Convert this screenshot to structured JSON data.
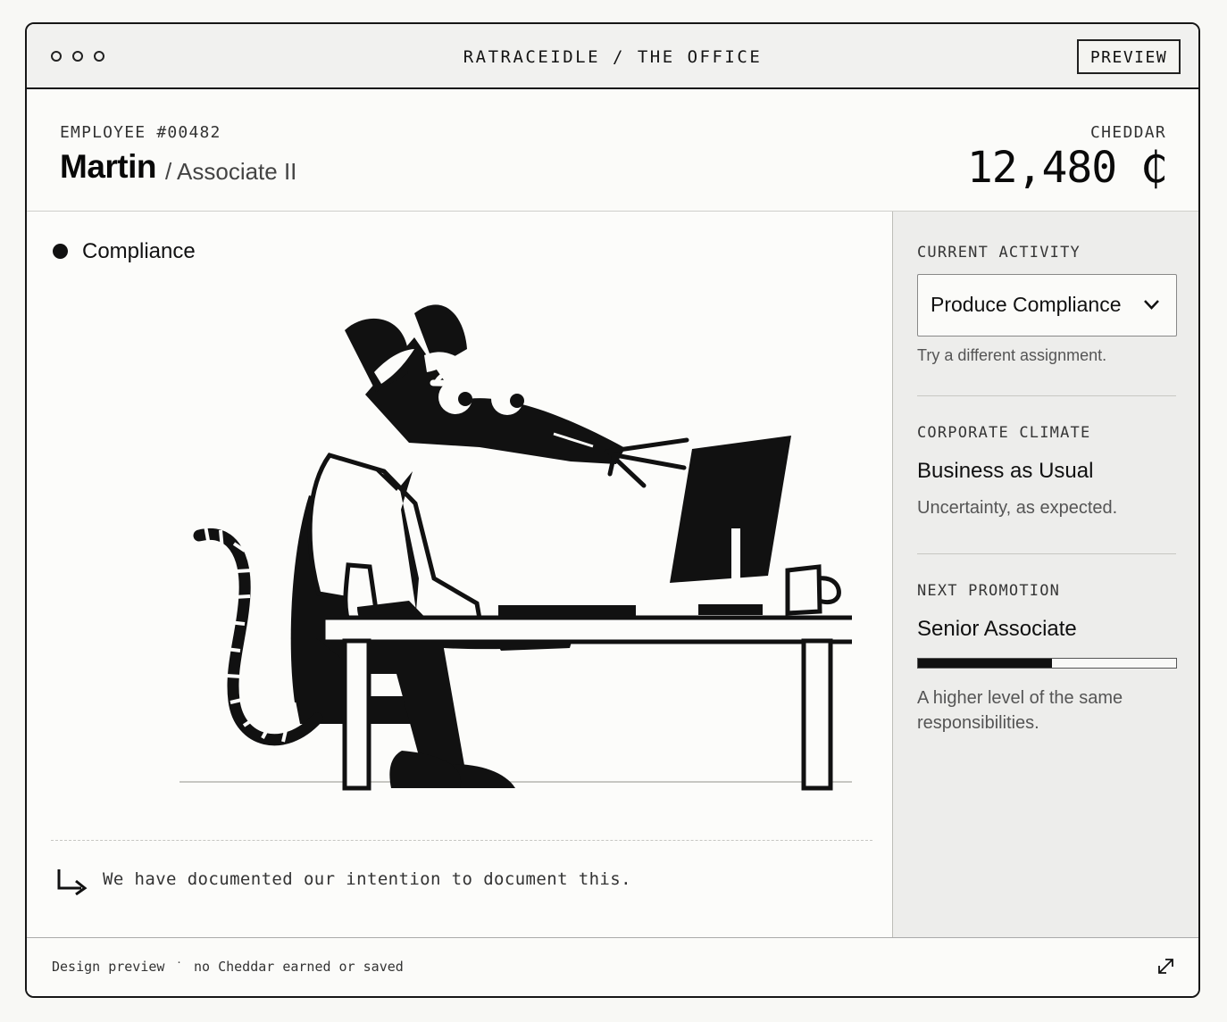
{
  "window": {
    "title": "RATRACEIDLE / THE OFFICE",
    "preview_button": "PREVIEW"
  },
  "employee": {
    "id_label": "EMPLOYEE #00482",
    "name": "Martin",
    "role": "/ Associate II"
  },
  "cheddar": {
    "label": "CHEDDAR",
    "amount": "12,480 ₵"
  },
  "main": {
    "section_title": "Compliance",
    "footnote": "We have documented our intention to document this."
  },
  "sidebar": {
    "current_activity": {
      "label": "CURRENT ACTIVITY",
      "selected": "Produce Compliance",
      "help": "Try a different assignment."
    },
    "corporate_climate": {
      "label": "CORPORATE CLIMATE",
      "value": "Business as Usual",
      "note": "Uncertainty, as expected."
    },
    "next_promotion": {
      "label": "NEXT PROMOTION",
      "value": "Senior Associate",
      "progress_fraction": 0.52,
      "note": "A higher level of the same responsibilities."
    }
  },
  "footer": {
    "left_text": "Design preview",
    "separator": "·",
    "right_text": "no Cheddar earned or saved"
  },
  "icons": {
    "window_controls": "three-outline-circle-icons",
    "activity_chevron": "chevron-down-icon",
    "footnote_arrow": "arrow-return-icon",
    "expand": "expand-icon",
    "illustration": "rat-office-worker-illustration"
  },
  "colors": {
    "ink": "#111111",
    "paper": "#fbfbf9",
    "sidebar": "#ededeb",
    "titlebar": "#f1f1ef",
    "divider": "#c7c7c2"
  }
}
